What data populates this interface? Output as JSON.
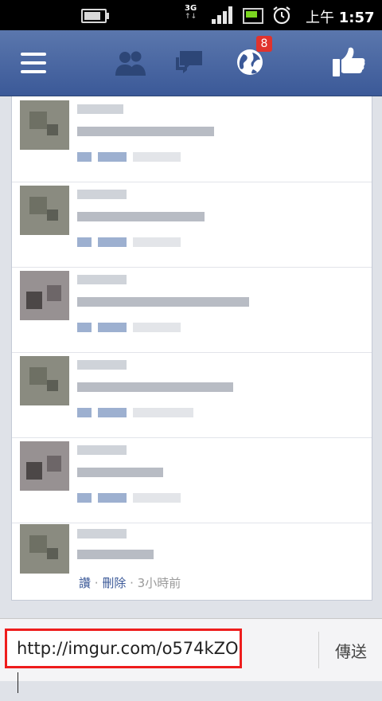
{
  "status_bar": {
    "network": "3G",
    "time_period": "上午",
    "time": "1:57",
    "icons": [
      "battery-icon",
      "signal-icon",
      "charging-icon",
      "alarm-icon"
    ]
  },
  "nav": {
    "icons": [
      "menu-icon",
      "friends-icon",
      "messages-icon",
      "notifications-globe-icon",
      "like-icon"
    ],
    "notification_count": "8",
    "badge_color": "#e0332d",
    "bar_color": "#3b5998"
  },
  "feed": {
    "last_comment_meta": {
      "like": "讚",
      "sep1": " · ",
      "delete": "刪除",
      "sep2": " · ",
      "time": "3小時前"
    }
  },
  "composer": {
    "input_value": "http://imgur.com/o574kZO",
    "send_label": "傳送",
    "highlight_color": "#ee1d1d"
  }
}
